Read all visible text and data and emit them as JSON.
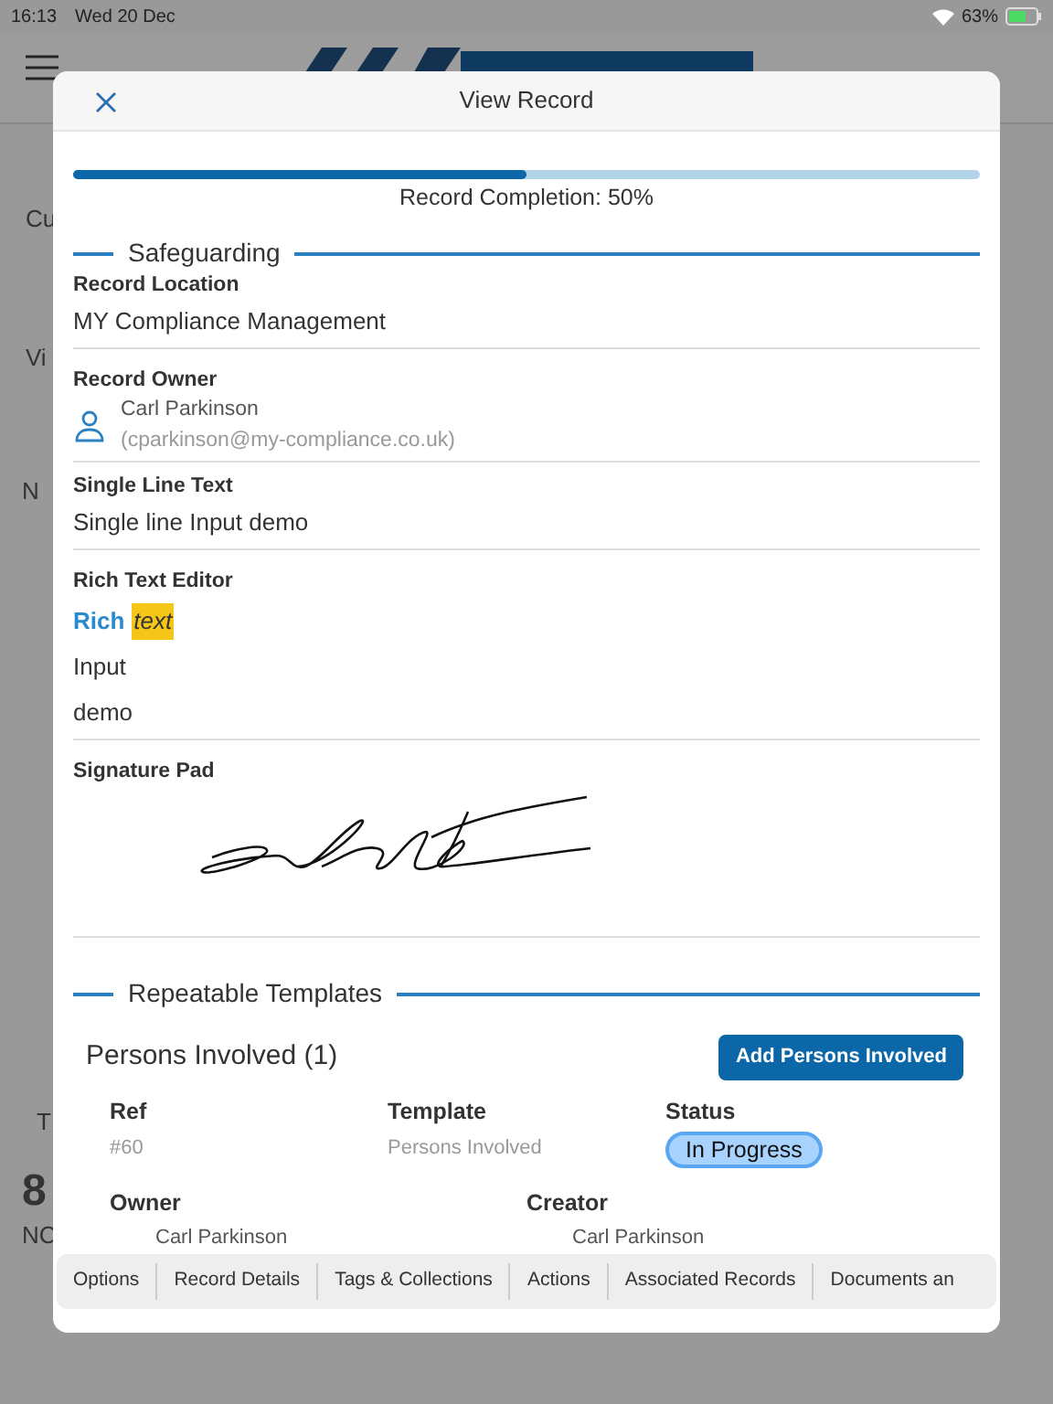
{
  "status_bar": {
    "time": "16:13",
    "date": "Wed 20 Dec",
    "battery": "63%"
  },
  "background": {
    "fragments": [
      "Cu",
      "Vi",
      "N",
      "T",
      "8",
      "NC"
    ]
  },
  "modal": {
    "title": "View Record",
    "completion": {
      "level": 0.5,
      "label": "Record Completion: 50%"
    },
    "section": {
      "title": "Safeguarding",
      "fields": [
        {
          "kind": "text",
          "label": "Record Location",
          "value": "MY Compliance Management"
        },
        {
          "kind": "person",
          "label": "Record Owner",
          "name": "Carl Parkinson",
          "email": "(cparkinson@my-compliance.co.uk)"
        },
        {
          "kind": "text",
          "label": "Single Line Text",
          "value": "Single line Input demo"
        },
        {
          "kind": "rich",
          "label": "Rich Text Editor",
          "first_line": [
            {
              "text": "Rich",
              "kind": "bold"
            },
            {
              "text": "text",
              "kind": "highlight"
            }
          ],
          "lines": [
            "Input",
            "demo"
          ]
        },
        {
          "kind": "signature",
          "label": "Signature Pad"
        }
      ]
    },
    "repeatable": {
      "title": "Repeatable Templates",
      "subtitle": "Persons Involved (1)",
      "button": "Add Persons Involved",
      "row1": [
        {
          "label": "Ref",
          "value": "#60",
          "kind": "text"
        },
        {
          "label": "Template",
          "value": "Persons Involved",
          "kind": "text"
        },
        {
          "label": "Status",
          "value": "In Progress",
          "kind": "badge"
        }
      ],
      "row2": [
        {
          "label": "Owner",
          "value": "Carl Parkinson"
        },
        {
          "label": "Creator",
          "value": "Carl Parkinson"
        }
      ]
    },
    "tabs": [
      "Options",
      "Record Details",
      "Tags & Collections",
      "Actions",
      "Associated Records",
      "Documents an"
    ]
  }
}
